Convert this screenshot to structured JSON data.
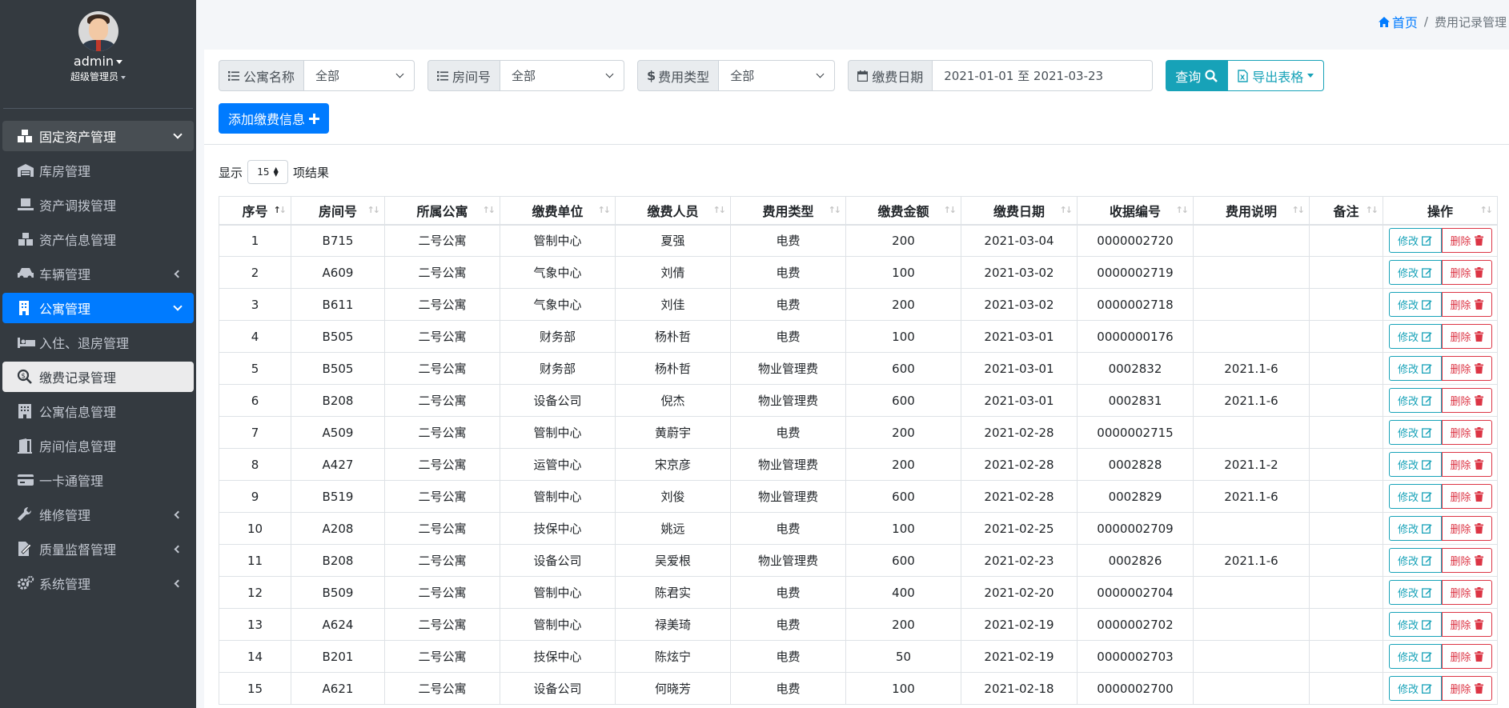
{
  "user": {
    "name": "admin",
    "role": "超级管理员"
  },
  "sidebar": {
    "items": [
      {
        "label": "固定资产管理",
        "icon": "cubes-icon"
      },
      {
        "label": "库房管理",
        "icon": "warehouse-icon"
      },
      {
        "label": "资产调拨管理",
        "icon": "dolly-icon"
      },
      {
        "label": "资产信息管理",
        "icon": "boxes-icon"
      },
      {
        "label": "车辆管理",
        "icon": "car-icon"
      },
      {
        "label": "公寓管理",
        "icon": "building-icon"
      },
      {
        "label": "入住、退房管理",
        "icon": "bed-icon"
      },
      {
        "label": "缴费记录管理",
        "icon": "search-dollar-icon"
      },
      {
        "label": "公寓信息管理",
        "icon": "hotel-icon"
      },
      {
        "label": "房间信息管理",
        "icon": "door-icon"
      },
      {
        "label": "一卡通管理",
        "icon": "credit-card-icon"
      },
      {
        "label": "维修管理",
        "icon": "wrench-icon"
      },
      {
        "label": "质量监督管理",
        "icon": "file-signature-icon"
      },
      {
        "label": "系统管理",
        "icon": "cogs-icon"
      }
    ]
  },
  "breadcrumb": {
    "home": "首页",
    "current": "费用记录管理"
  },
  "filters": {
    "apartment": {
      "label": "公寓名称",
      "value": "全部"
    },
    "room": {
      "label": "房间号",
      "value": "全部"
    },
    "fee_type": {
      "label": "费用类型",
      "value": "全部"
    },
    "date": {
      "label": "缴费日期",
      "value": "2021-01-01 至 2021-03-23"
    },
    "query_label": "查询",
    "export_label": "导出表格"
  },
  "add_label": "添加缴费信息",
  "show": {
    "prefix": "显示",
    "size": "15",
    "suffix": "项结果"
  },
  "table": {
    "headers": [
      "序号",
      "房间号",
      "所属公寓",
      "缴费单位",
      "缴费人员",
      "费用类型",
      "缴费金额",
      "缴费日期",
      "收据编号",
      "费用说明",
      "备注",
      "操作"
    ],
    "edit_label": "修改",
    "delete_label": "删除",
    "rows": [
      [
        "1",
        "B715",
        "二号公寓",
        "管制中心",
        "夏强",
        "电费",
        "200",
        "2021-03-04",
        "0000002720",
        "",
        ""
      ],
      [
        "2",
        "A609",
        "二号公寓",
        "气象中心",
        "刘倩",
        "电费",
        "100",
        "2021-03-02",
        "0000002719",
        "",
        ""
      ],
      [
        "3",
        "B611",
        "二号公寓",
        "气象中心",
        "刘佳",
        "电费",
        "200",
        "2021-03-02",
        "0000002718",
        "",
        ""
      ],
      [
        "4",
        "B505",
        "二号公寓",
        "财务部",
        "杨朴哲",
        "电费",
        "100",
        "2021-03-01",
        "0000000176",
        "",
        ""
      ],
      [
        "5",
        "B505",
        "二号公寓",
        "财务部",
        "杨朴哲",
        "物业管理费",
        "600",
        "2021-03-01",
        "0002832",
        "2021.1-6",
        ""
      ],
      [
        "6",
        "B208",
        "二号公寓",
        "设备公司",
        "倪杰",
        "物业管理费",
        "600",
        "2021-03-01",
        "0002831",
        "2021.1-6",
        ""
      ],
      [
        "7",
        "A509",
        "二号公寓",
        "管制中心",
        "黄蔚宇",
        "电费",
        "200",
        "2021-02-28",
        "0000002715",
        "",
        ""
      ],
      [
        "8",
        "A427",
        "二号公寓",
        "运管中心",
        "宋京彦",
        "物业管理费",
        "200",
        "2021-02-28",
        "0002828",
        "2021.1-2",
        ""
      ],
      [
        "9",
        "B519",
        "二号公寓",
        "管制中心",
        "刘俊",
        "物业管理费",
        "600",
        "2021-02-28",
        "0002829",
        "2021.1-6",
        ""
      ],
      [
        "10",
        "A208",
        "二号公寓",
        "技保中心",
        "姚远",
        "电费",
        "100",
        "2021-02-25",
        "0000002709",
        "",
        ""
      ],
      [
        "11",
        "B208",
        "二号公寓",
        "设备公司",
        "吴爱根",
        "物业管理费",
        "600",
        "2021-02-23",
        "0002826",
        "2021.1-6",
        ""
      ],
      [
        "12",
        "B509",
        "二号公寓",
        "管制中心",
        "陈君实",
        "电费",
        "400",
        "2021-02-20",
        "0000002704",
        "",
        ""
      ],
      [
        "13",
        "A624",
        "二号公寓",
        "管制中心",
        "禄美琦",
        "电费",
        "200",
        "2021-02-19",
        "0000002702",
        "",
        ""
      ],
      [
        "14",
        "B201",
        "二号公寓",
        "技保中心",
        "陈炫宁",
        "电费",
        "50",
        "2021-02-19",
        "0000002703",
        "",
        ""
      ],
      [
        "15",
        "A621",
        "二号公寓",
        "设备公司",
        "何晓芳",
        "电费",
        "100",
        "2021-02-18",
        "0000002700",
        "",
        ""
      ]
    ]
  }
}
